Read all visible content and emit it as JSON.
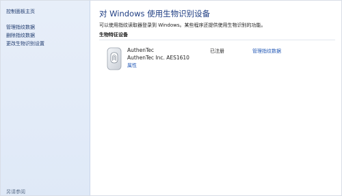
{
  "sidebar": {
    "home_link": "控制面板主页",
    "items": [
      {
        "label": "管理指纹数据"
      },
      {
        "label": "删除指纹数据"
      },
      {
        "label": "更改生物识别设置"
      }
    ],
    "see_also": "另请参阅"
  },
  "main": {
    "title": "对 Windows 使用生物识别设备",
    "description": "可以使用指纹读取器登录到 Windows。某些程序还提供使用生物识别的功能。",
    "section_title": "生物特征设备",
    "device": {
      "icon": "fingerprint-reader-icon",
      "name": "AuthenTec",
      "model": "AuthenTec Inc. AES1610",
      "properties_link": "属性",
      "status": "已注册",
      "manage_link": "管理指纹数据"
    }
  },
  "colors": {
    "sidebar_background": "#e3ecf8",
    "title_color": "#1e3d82",
    "link_color": "#1f56b5"
  }
}
